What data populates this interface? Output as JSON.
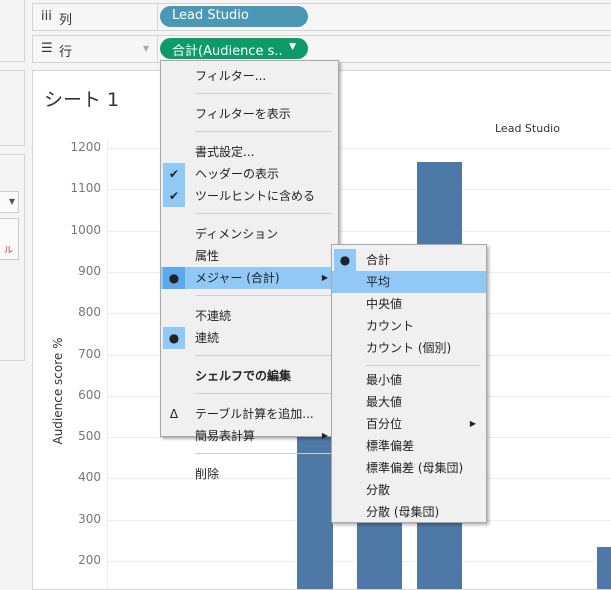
{
  "shelves": {
    "columns": {
      "icon": "columns-icon",
      "label": "列",
      "pill": "Lead Studio",
      "pill_color": "#4a98b4"
    },
    "rows": {
      "icon": "rows-icon",
      "label": "行",
      "pill": "合計(Audience  s..",
      "pill_color": "#0f9a6a"
    }
  },
  "sheet": {
    "title": "シート 1"
  },
  "left_panel": {
    "fragment": "ル"
  },
  "chart_data": {
    "type": "bar",
    "column_header": "Lead Studio",
    "ylabel": "Audience score %",
    "yticks": [
      200,
      300,
      400,
      500,
      600,
      700,
      800,
      900,
      1000,
      1100,
      1200
    ],
    "values": [
      620,
      480,
      1165,
      235
    ],
    "bar_color": "#4e79a7",
    "grid": true
  },
  "context_menu": {
    "items": [
      {
        "label": "フィルター..."
      },
      {
        "sep": true
      },
      {
        "label": "フィルターを表示"
      },
      {
        "sep": true
      },
      {
        "label": "書式設定..."
      },
      {
        "label": "ヘッダーの表示",
        "check": "✔"
      },
      {
        "label": "ツールヒントに含める",
        "check": "✔"
      },
      {
        "sep": true
      },
      {
        "label": "ディメンション"
      },
      {
        "label": "属性"
      },
      {
        "label": "メジャー (合計)",
        "check": "●",
        "submenu": true,
        "highlight": true
      },
      {
        "sep": true
      },
      {
        "label": "不連続"
      },
      {
        "label": "連続",
        "check": "●"
      },
      {
        "sep": true
      },
      {
        "label": "シェルフでの編集",
        "bold": true
      },
      {
        "sep": true
      },
      {
        "label": "テーブル計算を追加...",
        "icon": "Δ"
      },
      {
        "label": "簡易表計算",
        "submenu": true
      },
      {
        "sep": true
      },
      {
        "label": "削除"
      }
    ]
  },
  "measure_submenu": {
    "items": [
      {
        "label": "合計",
        "check": "●"
      },
      {
        "label": "平均",
        "highlight": true
      },
      {
        "label": "中央値"
      },
      {
        "label": "カウント"
      },
      {
        "label": "カウント (個別)"
      },
      {
        "sep": true
      },
      {
        "label": "最小値"
      },
      {
        "label": "最大値"
      },
      {
        "label": "百分位",
        "submenu": true
      },
      {
        "label": "標準偏差"
      },
      {
        "label": "標準偏差 (母集団)"
      },
      {
        "label": "分散"
      },
      {
        "label": "分散 (母集団)"
      }
    ]
  },
  "accent_highlight": "#90c8f6"
}
